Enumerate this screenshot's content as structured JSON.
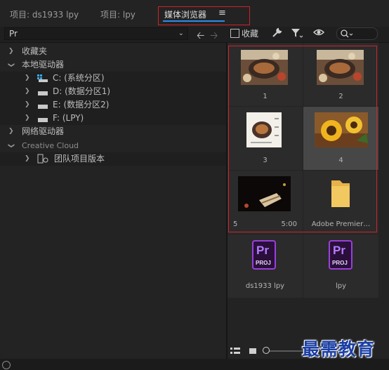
{
  "tabs": {
    "project1": "项目: ds1933 lpy",
    "project2": "项目: lpy",
    "media_browser": "媒体浏览器",
    "menu_glyph": "≡"
  },
  "toolbar": {
    "path_value": "Pr",
    "favorite_label": "收藏",
    "icons": [
      "back-arrow-icon",
      "forward-arrow-icon",
      "wrench-icon",
      "filter-icon",
      "eye-icon",
      "search-icon"
    ]
  },
  "tree": {
    "favorites": "收藏夹",
    "local_drives": "本地驱动器",
    "drives": [
      "C: (系统分区)",
      "D: (数据分区1)",
      "E: (数据分区2)",
      "F: (LPY)"
    ],
    "network_drives": "网络驱动器",
    "creative_cloud": "Creative Cloud",
    "team_projects": "团队项目版本"
  },
  "grid": {
    "items": [
      {
        "label": "1",
        "kind": "image"
      },
      {
        "label": "2",
        "kind": "image"
      },
      {
        "label": "3",
        "kind": "image"
      },
      {
        "label": "4",
        "kind": "image",
        "selected": true
      },
      {
        "label": "5",
        "duration": "5:00",
        "kind": "video"
      },
      {
        "label": "Adobe Premier…",
        "kind": "folder"
      },
      {
        "label": "ds1933 lpy",
        "kind": "project"
      },
      {
        "label": "lpy",
        "kind": "project"
      }
    ],
    "project_icon_text": {
      "main": "Pr",
      "sub": "PROJ"
    }
  },
  "watermark": "最需教育",
  "colors": {
    "accent_blue": "#2d8ceb",
    "highlight_red": "#d0202a",
    "premiere_purple": "#9a3fdb"
  }
}
